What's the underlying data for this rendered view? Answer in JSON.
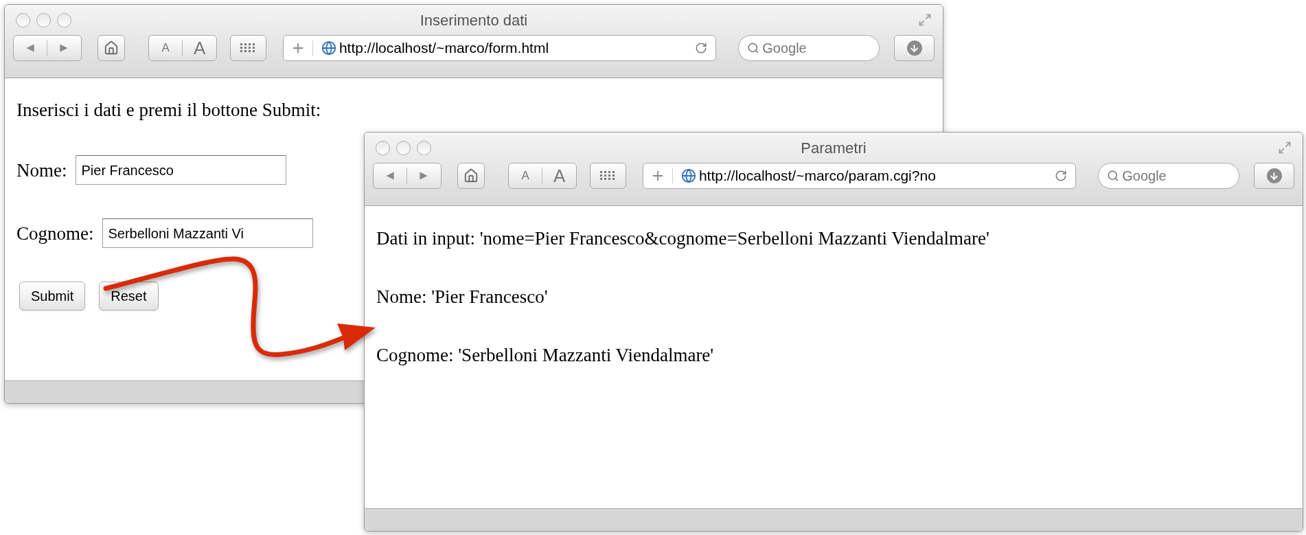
{
  "windows": [
    {
      "title": "Inserimento dati",
      "url": "http://localhost/~marco/form.html",
      "search_placeholder": "Google",
      "text_size": [
        "A",
        "A"
      ],
      "content": [
        {
          "kind": "paragraph",
          "text": "Inserisci i dati e premi il bottone Submit:"
        },
        {
          "kind": "field",
          "label": "Nome:",
          "value": "Pier Francesco"
        },
        {
          "kind": "field",
          "label": "Cognome:",
          "value": "Serbelloni Mazzanti Vi"
        },
        {
          "kind": "buttons",
          "buttons": [
            "Submit",
            "Reset"
          ]
        }
      ]
    },
    {
      "title": "Parametri",
      "url": "http://localhost/~marco/param.cgi?no",
      "search_placeholder": "Google",
      "text_size": [
        "A",
        "A"
      ],
      "content": [
        {
          "kind": "paragraph",
          "text": "Dati in input: 'nome=Pier Francesco&cognome=Serbelloni Mazzanti Viendalmare'"
        },
        {
          "kind": "paragraph",
          "text": "Nome: 'Pier Francesco'"
        },
        {
          "kind": "paragraph",
          "text": "Cognome: 'Serbelloni Mazzanti Viendalmare'"
        }
      ]
    }
  ]
}
